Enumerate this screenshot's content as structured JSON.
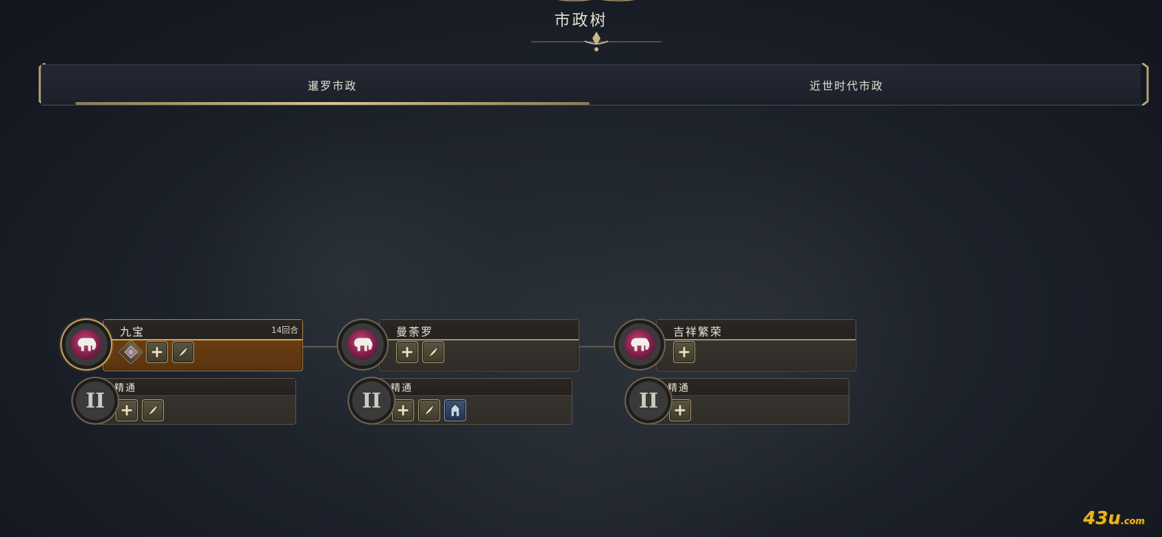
{
  "header": {
    "title": "市政树"
  },
  "tabs": [
    {
      "label": "暹罗市政",
      "selected": true
    },
    {
      "label": "近世时代市政",
      "selected": false
    }
  ],
  "nodes": [
    {
      "name": "九宝",
      "turns": "14回合",
      "active": true,
      "icon": "white-elephant-icon",
      "unlocks": [
        "wonder-icon",
        "plus-icon",
        "quill-icon"
      ],
      "mastery": {
        "name": "精通",
        "numeral": "II",
        "unlocks": [
          "plus-icon",
          "quill-icon"
        ]
      }
    },
    {
      "name": "曼荼罗",
      "active": false,
      "icon": "white-elephant-icon",
      "unlocks": [
        "plus-icon",
        "quill-icon"
      ],
      "mastery": {
        "name": "精通",
        "numeral": "II",
        "unlocks": [
          "plus-icon",
          "quill-icon",
          "building-icon"
        ]
      }
    },
    {
      "name": "吉祥繁荣",
      "active": false,
      "icon": "white-elephant-icon",
      "unlocks": [
        "plus-icon"
      ],
      "mastery": {
        "name": "精通",
        "numeral": "II",
        "unlocks": [
          "plus-icon"
        ]
      }
    }
  ],
  "watermark": {
    "brand": "43u",
    "suffix": ".com"
  },
  "colors": {
    "accent_gold": "#d4aa52",
    "elephant_disc": "#8c2452",
    "background": "#1b2029"
  }
}
